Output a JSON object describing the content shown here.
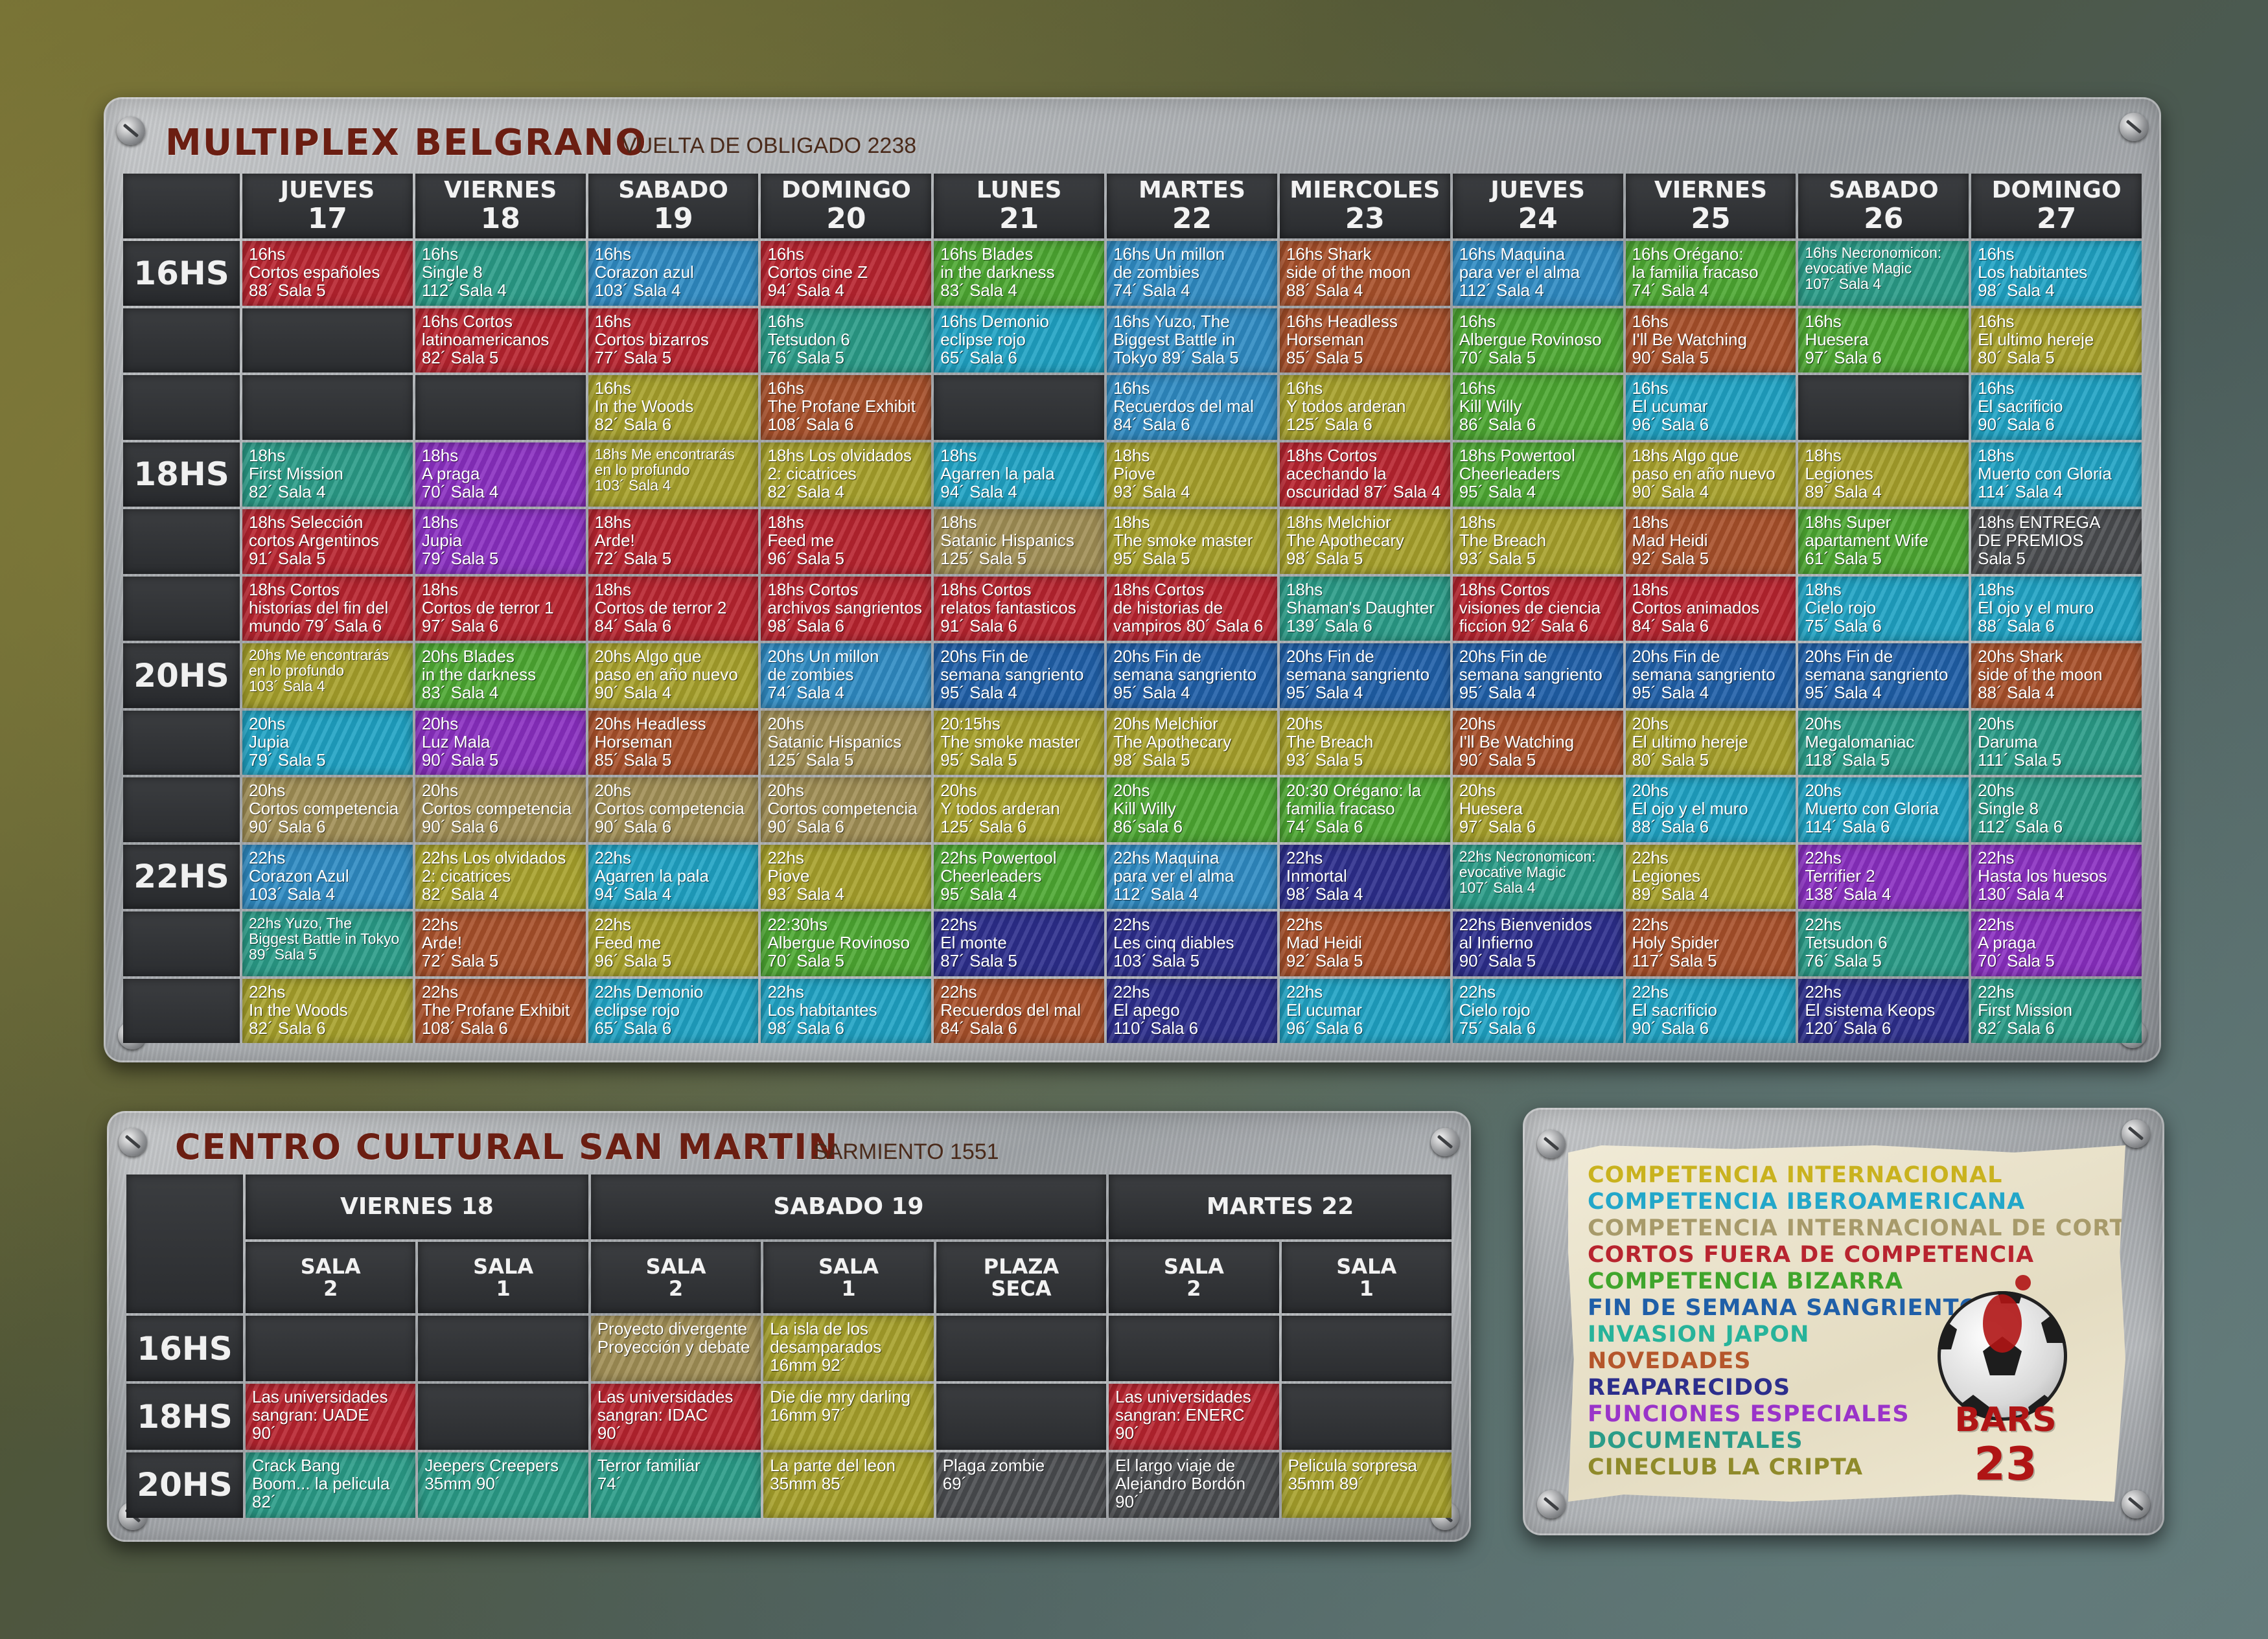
{
  "colors": {
    "red": "#b8242f",
    "teal": "#2a9c88",
    "blue": "#2f8bc3",
    "green": "#4da832",
    "cyan": "#1fa3c4",
    "olive": "#a7a12b",
    "purple": "#8a2fc1",
    "brown": "#a8502a",
    "navy": "#2c2e8c",
    "grey": "#4a4c4f",
    "khaki": "#a18f56",
    "dblue": "#1f5fa8",
    "title_red": "#6b1e12"
  },
  "multiplex": {
    "title": "MULTIPLEX BELGRANO",
    "address": "VUELTA DE OBLIGADO 2238",
    "days": [
      {
        "name": "JUEVES",
        "num": "17"
      },
      {
        "name": "VIERNES",
        "num": "18"
      },
      {
        "name": "SABADO",
        "num": "19"
      },
      {
        "name": "DOMINGO",
        "num": "20"
      },
      {
        "name": "LUNES",
        "num": "21"
      },
      {
        "name": "MARTES",
        "num": "22"
      },
      {
        "name": "MIERCOLES",
        "num": "23"
      },
      {
        "name": "JUEVES",
        "num": "24"
      },
      {
        "name": "VIERNES",
        "num": "25"
      },
      {
        "name": "SABADO",
        "num": "26"
      },
      {
        "name": "DOMINGO",
        "num": "27"
      }
    ],
    "time_labels": [
      "16HS",
      "18HS",
      "20HS",
      "22HS"
    ],
    "rows": [
      {
        "time": "16HS",
        "cells": [
          {
            "c": "red",
            "t": "16hs\nCortos españoles\n88´ Sala 5"
          },
          {
            "c": "teal",
            "t": "16hs\nSingle 8\n112´ Sala 4"
          },
          {
            "c": "blue",
            "t": "16hs\nCorazon azul\n103´ Sala 4"
          },
          {
            "c": "red",
            "t": "16hs\nCortos cine Z\n94´ Sala 4"
          },
          {
            "c": "green",
            "t": "16hs Blades\nin the darkness\n83´ Sala 4"
          },
          {
            "c": "blue",
            "t": "16hs Un millon\nde zombies\n74´ Sala 4"
          },
          {
            "c": "brown",
            "t": "16hs Shark\nside of the moon\n88´ Sala 4"
          },
          {
            "c": "blue",
            "t": "16hs Maquina\npara ver el alma\n112´ Sala 4"
          },
          {
            "c": "green",
            "t": "16hs Orégano:\nla familia fracaso\n74´ Sala 4"
          },
          {
            "c": "teal",
            "t": "16hs Necronomicon:\nevocative Magic\n107´ Sala 4",
            "s": 1
          },
          {
            "c": "cyan",
            "t": "16hs\nLos habitantes\n98´ Sala 4"
          }
        ]
      },
      {
        "time": "",
        "cells": [
          {
            "c": "empty",
            "t": ""
          },
          {
            "c": "red",
            "t": "16hs Cortos\nlatinoamericanos\n82´ Sala 5"
          },
          {
            "c": "red",
            "t": "16hs\nCortos bizarros\n77´ Sala 5"
          },
          {
            "c": "teal",
            "t": "16hs\nTetsudon 6\n76´ Sala 5"
          },
          {
            "c": "cyan",
            "t": "16hs Demonio\neclipse rojo\n65´ Sala 6"
          },
          {
            "c": "blue",
            "t": "16hs Yuzo, The\nBiggest Battle in\nTokyo 89´ Sala 5"
          },
          {
            "c": "brown",
            "t": "16hs Headless\nHorseman\n85´ Sala 5"
          },
          {
            "c": "green",
            "t": "16hs\nAlbergue Rovinoso\n70´ Sala 5"
          },
          {
            "c": "brown",
            "t": "16hs\nI'll Be Watching\n90´ Sala 5"
          },
          {
            "c": "green",
            "t": "16hs\nHuesera\n97´ Sala 6"
          },
          {
            "c": "olive",
            "t": "16hs\nEl ultimo hereje\n80´ Sala 5"
          }
        ]
      },
      {
        "time": "",
        "cells": [
          {
            "c": "empty",
            "t": ""
          },
          {
            "c": "empty",
            "t": ""
          },
          {
            "c": "olive",
            "t": "16hs\nIn the Woods\n82´ Sala 6"
          },
          {
            "c": "brown",
            "t": "16hs\nThe Profane Exhibit\n108´ Sala 6"
          },
          {
            "c": "empty",
            "t": ""
          },
          {
            "c": "blue",
            "t": "16hs\nRecuerdos del mal\n84´ Sala 6"
          },
          {
            "c": "olive",
            "t": "16hs\nY todos arderan\n125´ Sala 6"
          },
          {
            "c": "green",
            "t": "16hs\nKill Willy\n86´ Sala 6"
          },
          {
            "c": "cyan",
            "t": "16hs\nEl ucumar\n96´ Sala 6"
          },
          {
            "c": "empty",
            "t": ""
          },
          {
            "c": "cyan",
            "t": "16hs\nEl sacrificio\n90´ Sala 6"
          }
        ]
      },
      {
        "time": "18HS",
        "cells": [
          {
            "c": "teal",
            "t": "18hs\nFirst Mission\n82´ Sala 4"
          },
          {
            "c": "purple",
            "t": "18hs\nA praga\n70´ Sala 4"
          },
          {
            "c": "olive",
            "t": "18hs Me encontrarás\nen lo profundo\n103´ Sala 4",
            "s": 1
          },
          {
            "c": "olive",
            "t": "18hs Los olvidados\n2: cicatrices\n82´ Sala 4"
          },
          {
            "c": "cyan",
            "t": "18hs\nAgarren la pala\n94´ Sala 4"
          },
          {
            "c": "olive",
            "t": "18hs\nPiove\n93´ Sala 4"
          },
          {
            "c": "red",
            "t": "18hs Cortos\nacechando la\noscuridad 87´ Sala 4"
          },
          {
            "c": "green",
            "t": "18hs Powertool\nCheerleaders\n95´ Sala 4"
          },
          {
            "c": "olive",
            "t": "18hs Algo que\npaso en año nuevo\n90´ Sala 4"
          },
          {
            "c": "olive",
            "t": "18hs\nLegiones\n89´ Sala 4"
          },
          {
            "c": "cyan",
            "t": "18hs\nMuerto con Gloria\n114´ Sala 4"
          }
        ]
      },
      {
        "time": "",
        "cells": [
          {
            "c": "red",
            "t": "18hs Selección\ncortos Argentinos\n91´ Sala 5"
          },
          {
            "c": "purple",
            "t": "18hs\nJupia\n79´ Sala 5"
          },
          {
            "c": "red",
            "t": "18hs\nArde!\n72´ Sala 5"
          },
          {
            "c": "red",
            "t": "18hs\nFeed me\n96´ Sala 5"
          },
          {
            "c": "khaki",
            "t": "18hs\nSatanic Hispanics\n125´ Sala 5"
          },
          {
            "c": "olive",
            "t": "18hs\nThe smoke master\n95´ Sala 5"
          },
          {
            "c": "olive",
            "t": "18hs Melchior\nThe Apothecary\n98´ Sala 5"
          },
          {
            "c": "olive",
            "t": "18hs\nThe Breach\n93´ Sala 5"
          },
          {
            "c": "brown",
            "t": "18hs\nMad Heidi\n92´ Sala 5"
          },
          {
            "c": "green",
            "t": "18hs Super\napartament Wife\n61´ Sala 5"
          },
          {
            "c": "grey",
            "t": "18hs ENTREGA\nDE PREMIOS\nSala 5"
          }
        ]
      },
      {
        "time": "",
        "cells": [
          {
            "c": "red",
            "t": "18hs Cortos\nhistorias del fin del\nmundo 79´ Sala 6"
          },
          {
            "c": "red",
            "t": "18hs\nCortos de terror 1\n97´ Sala 6"
          },
          {
            "c": "red",
            "t": "18hs\nCortos de terror 2\n84´ Sala 6"
          },
          {
            "c": "red",
            "t": "18hs Cortos\narchivos sangrientos\n98´ Sala 6"
          },
          {
            "c": "red",
            "t": "18hs Cortos\nrelatos fantasticos\n91´ Sala 6"
          },
          {
            "c": "red",
            "t": "18hs Cortos\nde historias de\nvampiros 80´ Sala 6"
          },
          {
            "c": "teal",
            "t": "18hs\nShaman's Daughter\n139´ Sala 6"
          },
          {
            "c": "red",
            "t": "18hs Cortos\nvisiones de ciencia\nficcion 92´ Sala 6"
          },
          {
            "c": "red",
            "t": "18hs\nCortos animados\n84´ Sala 6"
          },
          {
            "c": "cyan",
            "t": "18hs\nCielo rojo\n75´ Sala 6"
          },
          {
            "c": "cyan",
            "t": "18hs\nEl ojo y el muro\n88´ Sala 6"
          }
        ]
      },
      {
        "time": "20HS",
        "cells": [
          {
            "c": "olive",
            "t": "20hs Me encontrarás\nen lo profundo\n103´ Sala 4",
            "s": 1
          },
          {
            "c": "green",
            "t": "20hs Blades\nin the darkness\n83´ Sala 4"
          },
          {
            "c": "olive",
            "t": "20hs Algo que\npaso en año nuevo\n90´ Sala 4"
          },
          {
            "c": "blue",
            "t": "20hs Un millon\nde zombies\n74´ Sala 4"
          },
          {
            "c": "dblue",
            "t": "20hs Fin de\nsemana sangriento\n95´ Sala 4"
          },
          {
            "c": "dblue",
            "t": "20hs Fin de\nsemana sangriento\n95´ Sala 4"
          },
          {
            "c": "dblue",
            "t": "20hs Fin de\nsemana sangriento\n95´ Sala 4"
          },
          {
            "c": "dblue",
            "t": "20hs Fin de\nsemana sangriento\n95´ Sala 4"
          },
          {
            "c": "dblue",
            "t": "20hs Fin de\nsemana sangriento\n95´ Sala 4"
          },
          {
            "c": "dblue",
            "t": "20hs Fin de\nsemana sangriento\n95´ Sala 4"
          },
          {
            "c": "brown",
            "t": "20hs Shark\nside of the moon\n88´ Sala 4"
          }
        ]
      },
      {
        "time": "",
        "cells": [
          {
            "c": "cyan",
            "t": "20hs\nJupia\n79´ Sala 5"
          },
          {
            "c": "purple",
            "t": "20hs\nLuz Mala\n90´ Sala 5"
          },
          {
            "c": "brown",
            "t": "20hs Headless\nHorseman\n85´ Sala 5"
          },
          {
            "c": "khaki",
            "t": "20hs\nSatanic Hispanics\n125´ Sala 5"
          },
          {
            "c": "olive",
            "t": "20:15hs\nThe smoke master\n95´ Sala 5"
          },
          {
            "c": "olive",
            "t": "20hs Melchior\nThe Apothecary\n98´ Sala 5"
          },
          {
            "c": "olive",
            "t": "20hs\nThe Breach\n93´ Sala 5"
          },
          {
            "c": "brown",
            "t": "20hs\nI'll Be Watching\n90´ Sala 5"
          },
          {
            "c": "olive",
            "t": "20hs\nEl ultimo hereje\n80´ Sala 5"
          },
          {
            "c": "teal",
            "t": "20hs\nMegalomaniac\n118´ Sala 5"
          },
          {
            "c": "teal",
            "t": "20hs\nDaruma\n111´ Sala 5"
          }
        ]
      },
      {
        "time": "",
        "cells": [
          {
            "c": "khaki",
            "t": "20hs\nCortos competencia\n90´ Sala 6"
          },
          {
            "c": "khaki",
            "t": "20hs\nCortos competencia\n90´ Sala 6"
          },
          {
            "c": "khaki",
            "t": "20hs\nCortos competencia\n90´ Sala 6"
          },
          {
            "c": "khaki",
            "t": "20hs\nCortos competencia\n90´ Sala 6"
          },
          {
            "c": "olive",
            "t": "20hs\nY todos arderan\n125´ Sala 6"
          },
          {
            "c": "green",
            "t": "20hs\nKill Willy\n86´sala 6"
          },
          {
            "c": "green",
            "t": "20:30 Orégano: la\nfamilia fracaso\n74´ Sala 6"
          },
          {
            "c": "olive",
            "t": "20hs\nHuesera\n97´ Sala 6"
          },
          {
            "c": "cyan",
            "t": "20hs\nEl ojo y el muro\n88´ Sala 6"
          },
          {
            "c": "cyan",
            "t": "20hs\nMuerto con Gloria\n114´ Sala 6"
          },
          {
            "c": "teal",
            "t": "20hs\nSingle 8\n112´ Sala 6"
          }
        ]
      },
      {
        "time": "22HS",
        "cells": [
          {
            "c": "blue",
            "t": "22hs\nCorazon Azul\n103´ Sala 4"
          },
          {
            "c": "olive",
            "t": "22hs Los olvidados\n2: cicatrices\n82´ Sala 4"
          },
          {
            "c": "cyan",
            "t": "22hs\nAgarren la pala\n94´ Sala 4"
          },
          {
            "c": "olive",
            "t": "22hs\nPiove\n93´ Sala 4"
          },
          {
            "c": "green",
            "t": "22hs Powertool\nCheerleaders\n95´ Sala 4"
          },
          {
            "c": "blue",
            "t": "22hs Maquina\npara ver el alma\n112´ Sala 4"
          },
          {
            "c": "navy",
            "t": "22hs\nInmortal\n98´ Sala 4"
          },
          {
            "c": "teal",
            "t": "22hs Necronomicon:\nevocative Magic\n107´ Sala 4",
            "s": 1
          },
          {
            "c": "olive",
            "t": "22hs\nLegiones\n89´ Sala 4"
          },
          {
            "c": "purple",
            "t": "22hs\nTerrifier 2\n138´ Sala 4"
          },
          {
            "c": "purple",
            "t": "22hs\nHasta los huesos\n130´ Sala 4"
          }
        ]
      },
      {
        "time": "",
        "cells": [
          {
            "c": "teal",
            "t": "22hs Yuzo, The\nBiggest Battle in Tokyo\n89´ Sala 5",
            "s": 1
          },
          {
            "c": "brown",
            "t": "22hs\nArde!\n72´ Sala 5"
          },
          {
            "c": "olive",
            "t": "22hs\nFeed me\n96´ Sala 5"
          },
          {
            "c": "green",
            "t": "22:30hs\nAlbergue Rovinoso\n70´ Sala 5"
          },
          {
            "c": "navy",
            "t": "22hs\nEl monte\n87´ Sala 5"
          },
          {
            "c": "navy",
            "t": "22hs\nLes cinq diables\n103´ Sala 5"
          },
          {
            "c": "brown",
            "t": "22hs\nMad Heidi\n92´ Sala 5"
          },
          {
            "c": "navy",
            "t": "22hs Bienvenidos\nal Infierno\n90´ Sala 5"
          },
          {
            "c": "brown",
            "t": "22hs\nHoly Spider\n117´ Sala 5"
          },
          {
            "c": "teal",
            "t": "22hs\nTetsudon 6\n76´ Sala 5"
          },
          {
            "c": "purple",
            "t": "22hs\nA praga\n70´ Sala 5"
          }
        ]
      },
      {
        "time": "",
        "cells": [
          {
            "c": "olive",
            "t": "22hs\nIn the Woods\n82´ Sala 6"
          },
          {
            "c": "brown",
            "t": "22hs\nThe Profane Exhibit\n108´ Sala 6"
          },
          {
            "c": "cyan",
            "t": "22hs Demonio\neclipse rojo\n65´ Sala 6"
          },
          {
            "c": "cyan",
            "t": "22hs\nLos habitantes\n98´ Sala 6"
          },
          {
            "c": "brown",
            "t": "22hs\nRecuerdos del mal\n84´ Sala 6"
          },
          {
            "c": "navy",
            "t": "22hs\nEl apego\n110´ Sala 6"
          },
          {
            "c": "cyan",
            "t": "22hs\nEl ucumar\n96´ Sala 6"
          },
          {
            "c": "cyan",
            "t": "22hs\nCielo rojo\n75´ Sala 6"
          },
          {
            "c": "cyan",
            "t": "22hs\nEl sacrificio\n90´ Sala 6"
          },
          {
            "c": "navy",
            "t": "22hs\nEl sistema Keops\n120´ Sala 6"
          },
          {
            "c": "teal",
            "t": "22hs\nFirst Mission\n82´ Sala 6"
          }
        ]
      }
    ]
  },
  "ccsm": {
    "title": "CENTRO CULTURAL SAN MARTIN",
    "address": "SARMIENTO 1551",
    "days": [
      {
        "label": "VIERNES 18",
        "span": 2
      },
      {
        "label": "SABADO 19",
        "span": 3
      },
      {
        "label": "MARTES 22",
        "span": 2
      }
    ],
    "salas": [
      "SALA\n2",
      "SALA\n1",
      "SALA\n2",
      "SALA\n1",
      "PLAZA\nSECA",
      "SALA\n2",
      "SALA\n1"
    ],
    "rows": [
      {
        "time": "16HS",
        "cells": [
          {
            "c": "empty",
            "t": ""
          },
          {
            "c": "empty",
            "t": ""
          },
          {
            "c": "khaki",
            "t": "Proyecto divergente\nProyección y debate"
          },
          {
            "c": "olive",
            "t": "La isla de los\ndesamparados\n16mm 92´"
          },
          {
            "c": "empty",
            "t": ""
          },
          {
            "c": "empty",
            "t": ""
          },
          {
            "c": "empty",
            "t": ""
          }
        ]
      },
      {
        "time": "18HS",
        "cells": [
          {
            "c": "red",
            "t": "Las universidades\nsangran: UADE\n90´"
          },
          {
            "c": "empty",
            "t": ""
          },
          {
            "c": "red",
            "t": "Las universidades\nsangran: IDAC\n90´"
          },
          {
            "c": "olive",
            "t": "Die die mry darling\n16mm 97´"
          },
          {
            "c": "empty",
            "t": ""
          },
          {
            "c": "red",
            "t": "Las universidades\nsangran: ENERC\n90´"
          },
          {
            "c": "empty",
            "t": ""
          }
        ]
      },
      {
        "time": "20HS",
        "cells": [
          {
            "c": "teal",
            "t": "Crack Bang\nBoom... la pelicula\n82´"
          },
          {
            "c": "teal",
            "t": "Jeepers Creepers\n35mm 90´"
          },
          {
            "c": "teal",
            "t": "Terror familiar\n74´"
          },
          {
            "c": "olive",
            "t": "La parte del leon\n35mm 85´"
          },
          {
            "c": "grey",
            "t": "Plaga zombie\n69´"
          },
          {
            "c": "grey",
            "t": "El largo viaje de\nAlejandro Bordón\n90´"
          },
          {
            "c": "olive",
            "t": "Pelicula sorpresa\n35mm 89´"
          }
        ]
      }
    ]
  },
  "legend": {
    "items": [
      {
        "label": "COMPETENCIA INTERNACIONAL",
        "color": "#c9b21e"
      },
      {
        "label": "COMPETENCIA IBEROAMERICANA",
        "color": "#23a7c9"
      },
      {
        "label": "COMPETENCIA INTERNACIONAL DE CORTOS",
        "color": "#a79a6a"
      },
      {
        "label": "CORTOS FUERA DE COMPETENCIA",
        "color": "#b8242f"
      },
      {
        "label": "COMPETENCIA BIZARRA",
        "color": "#3fa52c"
      },
      {
        "label": "FIN DE SEMANA SANGRIENTO",
        "color": "#1f5fa8"
      },
      {
        "label": "INVASION JAPON",
        "color": "#27b39a"
      },
      {
        "label": "NOVEDADES",
        "color": "#b5562b"
      },
      {
        "label": "REAPARECIDOS",
        "color": "#2c2e8c"
      },
      {
        "label": "FUNCIONES ESPECIALES",
        "color": "#9a34c9"
      },
      {
        "label": "DOCUMENTALES",
        "color": "#2a9c88"
      },
      {
        "label": "CINECLUB LA CRIPTA",
        "color": "#8f8a2a"
      }
    ],
    "logo": {
      "line1": "BARS",
      "line2": "23"
    }
  }
}
